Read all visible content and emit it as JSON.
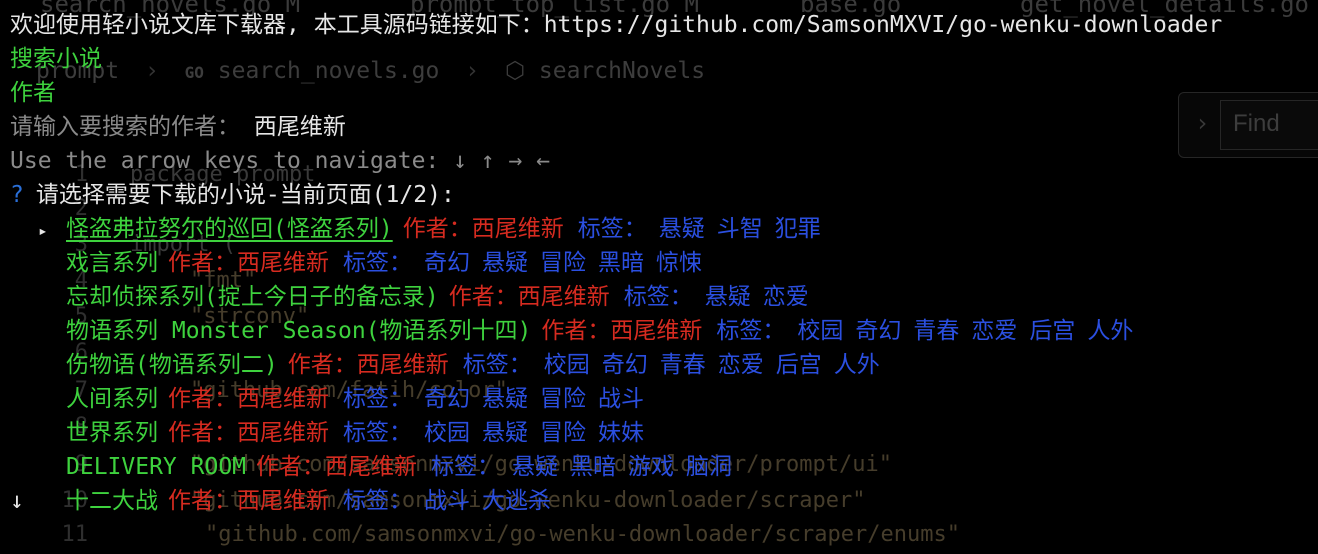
{
  "background_editor": {
    "tabs": [
      "search_novels.go M",
      "prompt_top_list.go M",
      "base.go",
      "get_novel_details.go"
    ],
    "breadcrumb": {
      "folder": "prompt",
      "file": "search_novels.go",
      "symbol": "searchNovels"
    },
    "find": {
      "placeholder": "Find"
    },
    "code_lines": [
      {
        "num": "1",
        "text": "package prompt"
      },
      {
        "num": "2",
        "text": ""
      },
      {
        "num": "3",
        "text": "import ("
      },
      {
        "num": "4",
        "text": "\"fmt\""
      },
      {
        "num": "5",
        "text": "\"strconv\""
      },
      {
        "num": "6",
        "text": ""
      },
      {
        "num": "7",
        "text": "\"github.com/fatih/color\""
      },
      {
        "num": "8",
        "text": ""
      },
      {
        "num": "9",
        "text": "\"github.com/samsonmxvi/go-wenku-downloader/prompt/ui\""
      },
      {
        "num": "10",
        "text": "\"github.com/samsonmxvi/go-wenku-downloader/scraper\""
      },
      {
        "num": "11",
        "text": "\"github.com/samsonmxvi/go-wenku-downloader/scraper/enums\""
      }
    ]
  },
  "terminal": {
    "welcome": "欢迎使用轻小说文库下载器, 本工具源码链接如下：https://github.com/SamsonMXVI/go-wenku-downloader",
    "menu_search": "搜索小说",
    "menu_author": "作者",
    "prompt_label": "请输入要搜索的作者：",
    "prompt_value": "西尾维新",
    "nav_hint": "Use the arrow keys to navigate: ↓ ↑ → ←",
    "question_mark": "?",
    "question": "请选择需要下载的小说-当前页面(1/2):",
    "selected_indicator": "▸",
    "more_indicator": "↓",
    "novels": [
      {
        "title": "怪盗弗拉努尔的巡回(怪盗系列)",
        "author": "作者：西尾维新",
        "tags_label": "标签：",
        "tags": [
          "悬疑",
          "斗智",
          "犯罪"
        ],
        "selected": true
      },
      {
        "title": "戏言系列",
        "author": "作者：西尾维新",
        "tags_label": "标签：",
        "tags": [
          "奇幻",
          "悬疑",
          "冒险",
          "黑暗",
          "惊悚"
        ],
        "selected": false
      },
      {
        "title": "忘却侦探系列(掟上今日子的备忘录)",
        "author": "作者：西尾维新",
        "tags_label": "标签：",
        "tags": [
          "悬疑",
          "恋爱"
        ],
        "selected": false
      },
      {
        "title": "物语系列 Monster Season(物语系列十四)",
        "author": "作者：西尾维新",
        "tags_label": "标签：",
        "tags": [
          "校园",
          "奇幻",
          "青春",
          "恋爱",
          "后宫",
          "人外"
        ],
        "selected": false
      },
      {
        "title": "伤物语(物语系列二)",
        "author": "作者：西尾维新",
        "tags_label": "标签：",
        "tags": [
          "校园",
          "奇幻",
          "青春",
          "恋爱",
          "后宫",
          "人外"
        ],
        "selected": false
      },
      {
        "title": "人间系列",
        "author": "作者：西尾维新",
        "tags_label": "标签：",
        "tags": [
          "奇幻",
          "悬疑",
          "冒险",
          "战斗"
        ],
        "selected": false
      },
      {
        "title": "世界系列",
        "author": "作者：西尾维新",
        "tags_label": "标签：",
        "tags": [
          "校园",
          "悬疑",
          "冒险",
          "妹妹"
        ],
        "selected": false
      },
      {
        "title": "DELIVERY ROOM",
        "author": "作者：西尾维新",
        "tags_label": "标签：",
        "tags": [
          "悬疑",
          "黑暗",
          "游戏",
          "脑洞"
        ],
        "selected": false
      },
      {
        "title": "十二大战",
        "author": "作者：西尾维新",
        "tags_label": "标签：",
        "tags": [
          "战斗",
          "大逃杀"
        ],
        "selected": false
      }
    ]
  },
  "colors": {
    "background": "#000000",
    "green": "#3ed23e",
    "red": "#d62b20",
    "blue": "#2b4fe0",
    "white": "#e6e6e6",
    "gray": "#8a8a8a"
  }
}
